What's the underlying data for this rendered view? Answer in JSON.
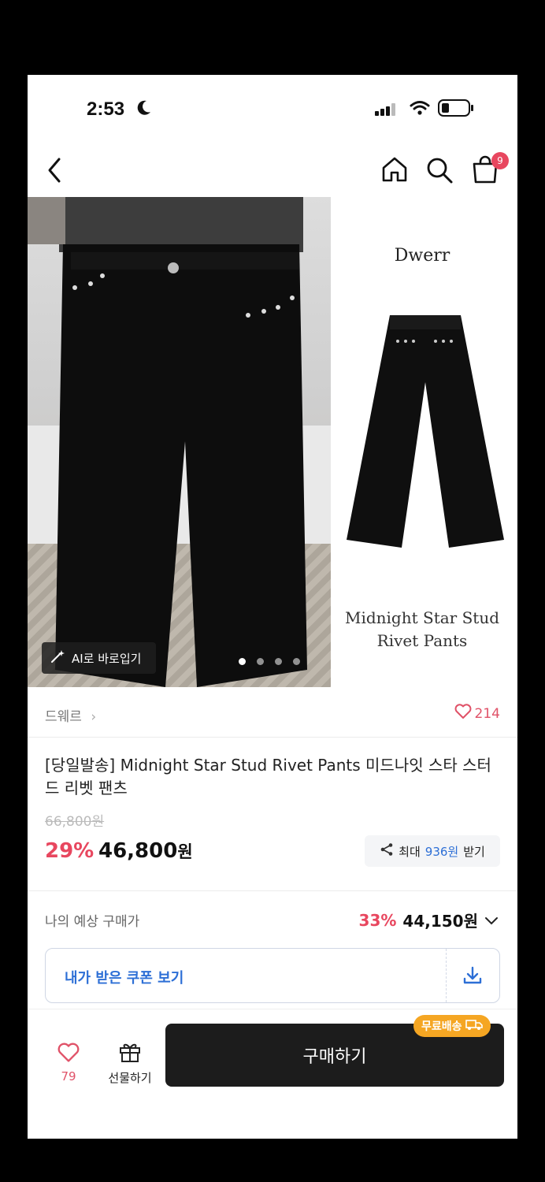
{
  "status_bar": {
    "time": "2:53"
  },
  "nav": {
    "cart_count": "9"
  },
  "hero": {
    "ai_button_label": "AI로 바로입기",
    "brand_word": "Dwerr",
    "product_name_line1": "Midnight Star Stud",
    "product_name_line2": "Rivet Pants",
    "dots_total": 4,
    "dots_active": 1
  },
  "product": {
    "brand": "드웨르",
    "likes": "214",
    "title": "[당일발송] Midnight Star Stud Rivet Pants 미드나잇 스타 스터드 리벳 팬츠",
    "original_price": "66,800원",
    "discount": "29%",
    "price_number": "46,800",
    "price_unit": "원",
    "reward_prefix": "최대",
    "reward_amount": "936원",
    "reward_suffix": "받기"
  },
  "expected": {
    "label": "나의 예상 구매가",
    "discount": "33%",
    "price": "44,150원"
  },
  "coupon": {
    "label": "내가 받은 쿠폰 보기"
  },
  "bottom": {
    "fav_count": "79",
    "gift_label": "선물하기",
    "buy_label": "구매하기",
    "free_shipping_label": "무료배송"
  },
  "colors": {
    "accent_red": "#e8475f",
    "link_blue": "#2d6fd6",
    "badge_orange": "#f5a623"
  }
}
